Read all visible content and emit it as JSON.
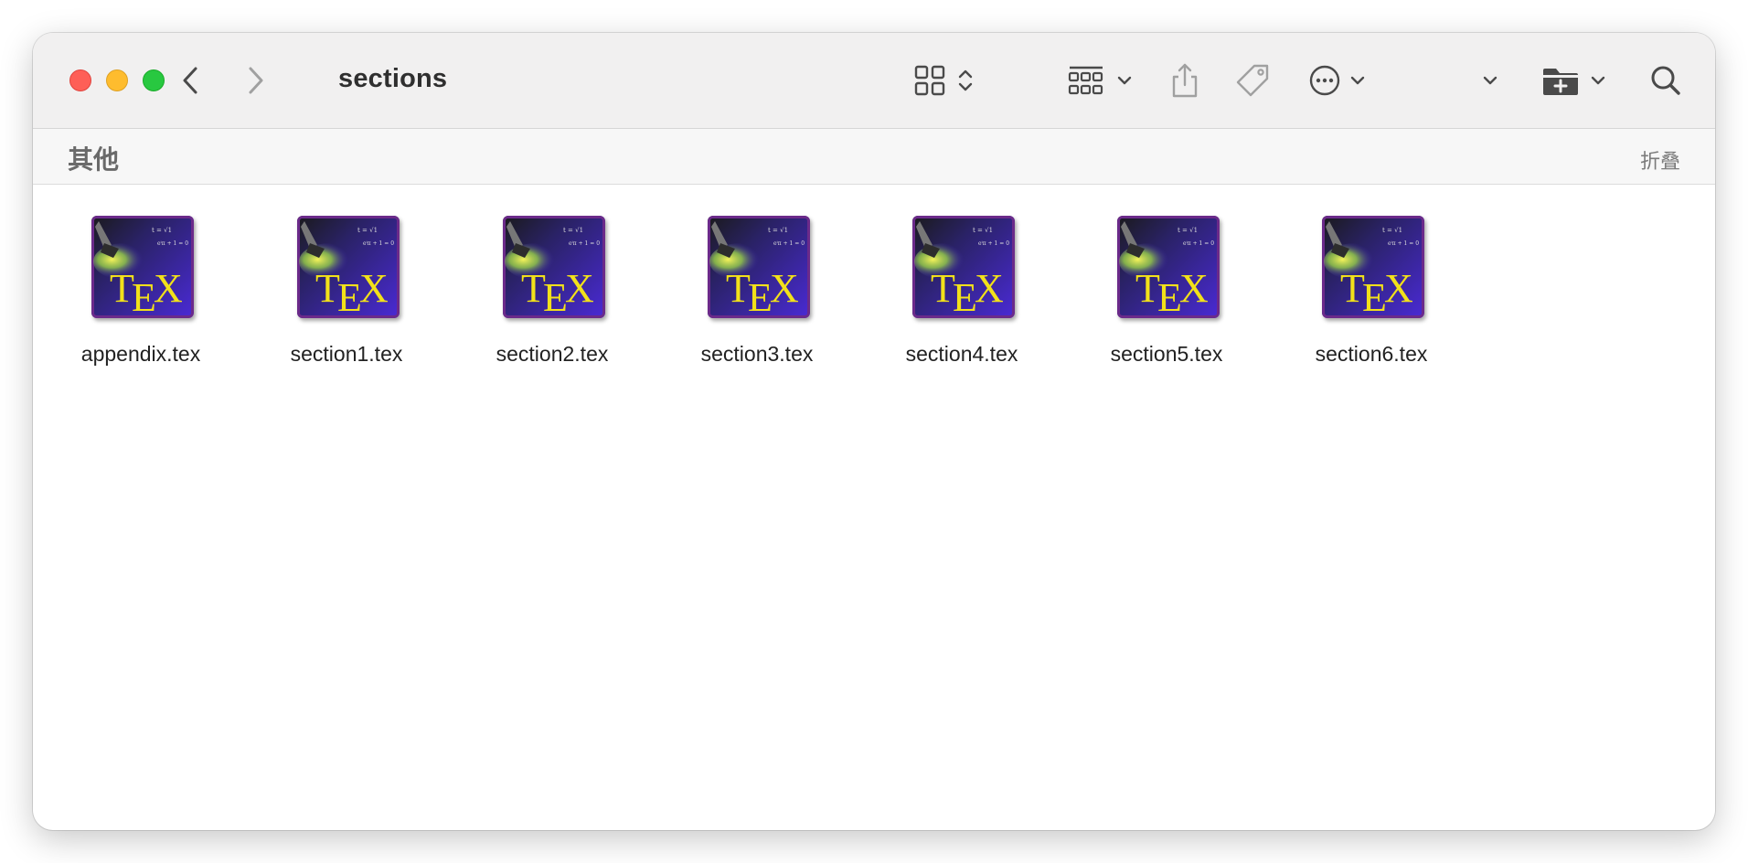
{
  "window": {
    "title": "sections"
  },
  "toolbar": {
    "back_icon": "chevron-left-icon",
    "forward_icon": "chevron-right-icon",
    "view_icon": "icon-grid-icon",
    "group_icon": "group-by-icon",
    "share_icon": "share-icon",
    "tag_icon": "tag-icon",
    "action_icon": "ellipsis-circle-icon",
    "new_folder_icon": "folder-plus-icon",
    "search_icon": "search-icon"
  },
  "group": {
    "title": "其他",
    "collapse_label": "折叠"
  },
  "files": [
    {
      "name": "appendix.tex",
      "icon": "tex-file-icon"
    },
    {
      "name": "section1.tex",
      "icon": "tex-file-icon"
    },
    {
      "name": "section2.tex",
      "icon": "tex-file-icon"
    },
    {
      "name": "section3.tex",
      "icon": "tex-file-icon"
    },
    {
      "name": "section4.tex",
      "icon": "tex-file-icon"
    },
    {
      "name": "section5.tex",
      "icon": "tex-file-icon"
    },
    {
      "name": "section6.tex",
      "icon": "tex-file-icon"
    }
  ],
  "colors": {
    "close": "#fe5f57",
    "minimize": "#febc2e",
    "maximize": "#28c840",
    "tex_icon_background": "#3a1fb8",
    "tex_letters": "#f2e11a"
  }
}
